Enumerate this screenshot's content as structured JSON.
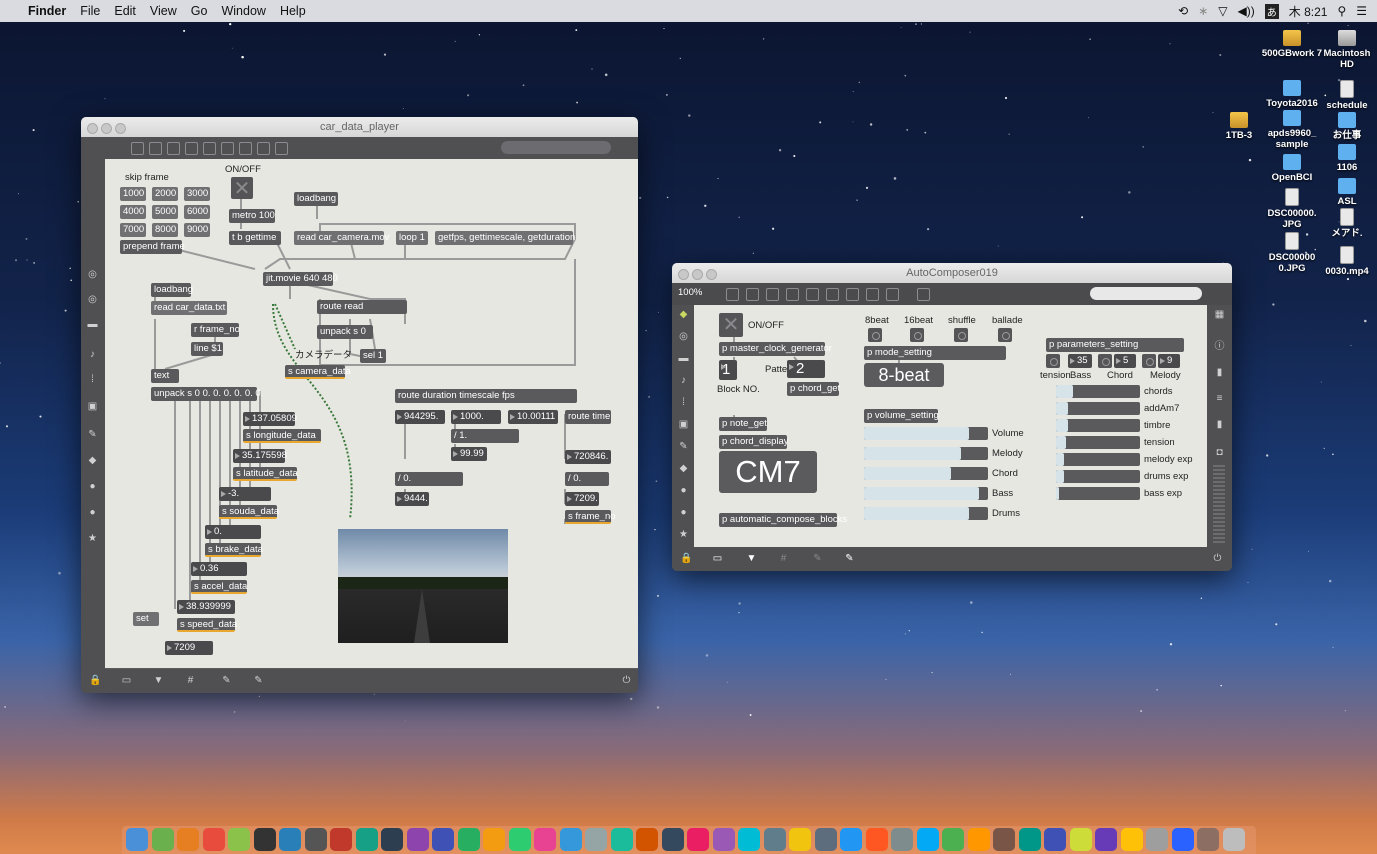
{
  "menubar": {
    "app": "Finder",
    "items": [
      "File",
      "Edit",
      "View",
      "Go",
      "Window",
      "Help"
    ],
    "clock": "木 8:21"
  },
  "desktop_icons": [
    {
      "label": "500GBwork 7",
      "kind": "drive"
    },
    {
      "label": "Macintosh HD",
      "kind": "hd"
    },
    {
      "label": "Toyota2016",
      "kind": "folder"
    },
    {
      "label": "schedule",
      "kind": "file"
    },
    {
      "label": "1TB-3",
      "kind": "drive"
    },
    {
      "label": "apds9960_ sample",
      "kind": "folder"
    },
    {
      "label": "お仕事",
      "kind": "folder"
    },
    {
      "label": "1106",
      "kind": "folder"
    },
    {
      "label": "OpenBCI",
      "kind": "folder"
    },
    {
      "label": "ASL",
      "kind": "folder"
    },
    {
      "label": "DSC00000. JPG",
      "kind": "file"
    },
    {
      "label": "メアド.",
      "kind": "file"
    },
    {
      "label": "DSC00000 0.JPG",
      "kind": "file"
    },
    {
      "label": "0030.mp4",
      "kind": "file"
    }
  ],
  "player": {
    "title": "car_data_player",
    "skip_label": "skip frame",
    "onoff_label": "ON/OFF",
    "skip_buttons": [
      "1000",
      "2000",
      "3000",
      "4000",
      "5000",
      "6000",
      "7000",
      "8000",
      "9000"
    ],
    "prepend": "prepend frame",
    "metro": "metro 100",
    "tb": "t b gettime",
    "loadbang1": "loadbang",
    "read_mov": "read car_camera.mov",
    "loop": "loop 1",
    "getfps": "getfps, gettimescale, getduration",
    "jitmovie": "jit.movie 640 480",
    "loadbang2": "loadbang",
    "read_txt": "read car_data.txt",
    "rframe": "r frame_no",
    "line": "line $1",
    "text": "text",
    "unpack": "unpack s 0 0. 0. 0. 0. 0. 0.",
    "route_read": "route read",
    "unpack_s0": "unpack s 0",
    "camera_label": "カメラデータ",
    "sel1": "sel 1",
    "s_camera": "s camera_data",
    "route_dur": "route duration timescale fps",
    "n944295": "944295.",
    "n1000": "1000.",
    "n10_00111": "10.00111",
    "route_time": "route time",
    "div1": "/ 1.",
    "n99_99": "99.99",
    "n720846": "720846.",
    "div0a": "/ 0.",
    "div0b": "/ 0.",
    "n9444": "9444.",
    "n7209b": "7209.",
    "s_frame": "s frame_no",
    "lon": "137.05809",
    "s_lon": "s longitude_data",
    "lat": "35.175598",
    "s_lat": "s latitude_data",
    "souda": "-3.",
    "s_souda": "s souda_data",
    "brake": "0.",
    "s_brake": "s brake_data",
    "accel": "0.36",
    "s_accel": "s accel_data",
    "speed": "38.939999",
    "s_speed": "s speed_data",
    "set": "set",
    "n7209": "7209"
  },
  "composer": {
    "title": "AutoComposer019",
    "zoom": "100%",
    "onoff_label": "ON/OFF",
    "clock_gen": "p master_clock_generator",
    "block_value": "1",
    "block_label": "Block NO.",
    "pattern_label": "Pattern",
    "pattern_value": "2",
    "chord_get": "p chord_get",
    "modes": [
      "8beat",
      "16beat",
      "shuffle",
      "ballade"
    ],
    "mode_setting": "p mode_setting",
    "mode_display": "8-beat",
    "note_get": "p note_get",
    "chord_display_obj": "p chord_display",
    "chord_display": "CM7",
    "auto_compose": "p automatic_compose_blocks",
    "volume_setting": "p volume_setting",
    "volumes": [
      {
        "name": "Volume",
        "level": 0.85
      },
      {
        "name": "Melody",
        "level": 0.78
      },
      {
        "name": "Chord",
        "level": 0.7
      },
      {
        "name": "Bass",
        "level": 0.93
      },
      {
        "name": "Drums",
        "level": 0.85
      }
    ],
    "params_setting": "p parameters_setting",
    "param_nums": [
      "35",
      "5",
      "9"
    ],
    "param_headers": [
      "tension",
      "Bass",
      "Chord",
      "Melody"
    ],
    "params": [
      {
        "name": "chords",
        "level": 0.2
      },
      {
        "name": "addAm7",
        "level": 0.14
      },
      {
        "name": "timbre",
        "level": 0.14
      },
      {
        "name": "tension",
        "level": 0.12
      },
      {
        "name": "melody exp",
        "level": 0.1
      },
      {
        "name": "drums exp",
        "level": 0.1
      },
      {
        "name": "bass exp",
        "level": 0.03
      }
    ]
  },
  "colors": {
    "accent": "#e8a830",
    "patcher_bg": "#e7e7e2",
    "object": "#5a5a5d"
  }
}
